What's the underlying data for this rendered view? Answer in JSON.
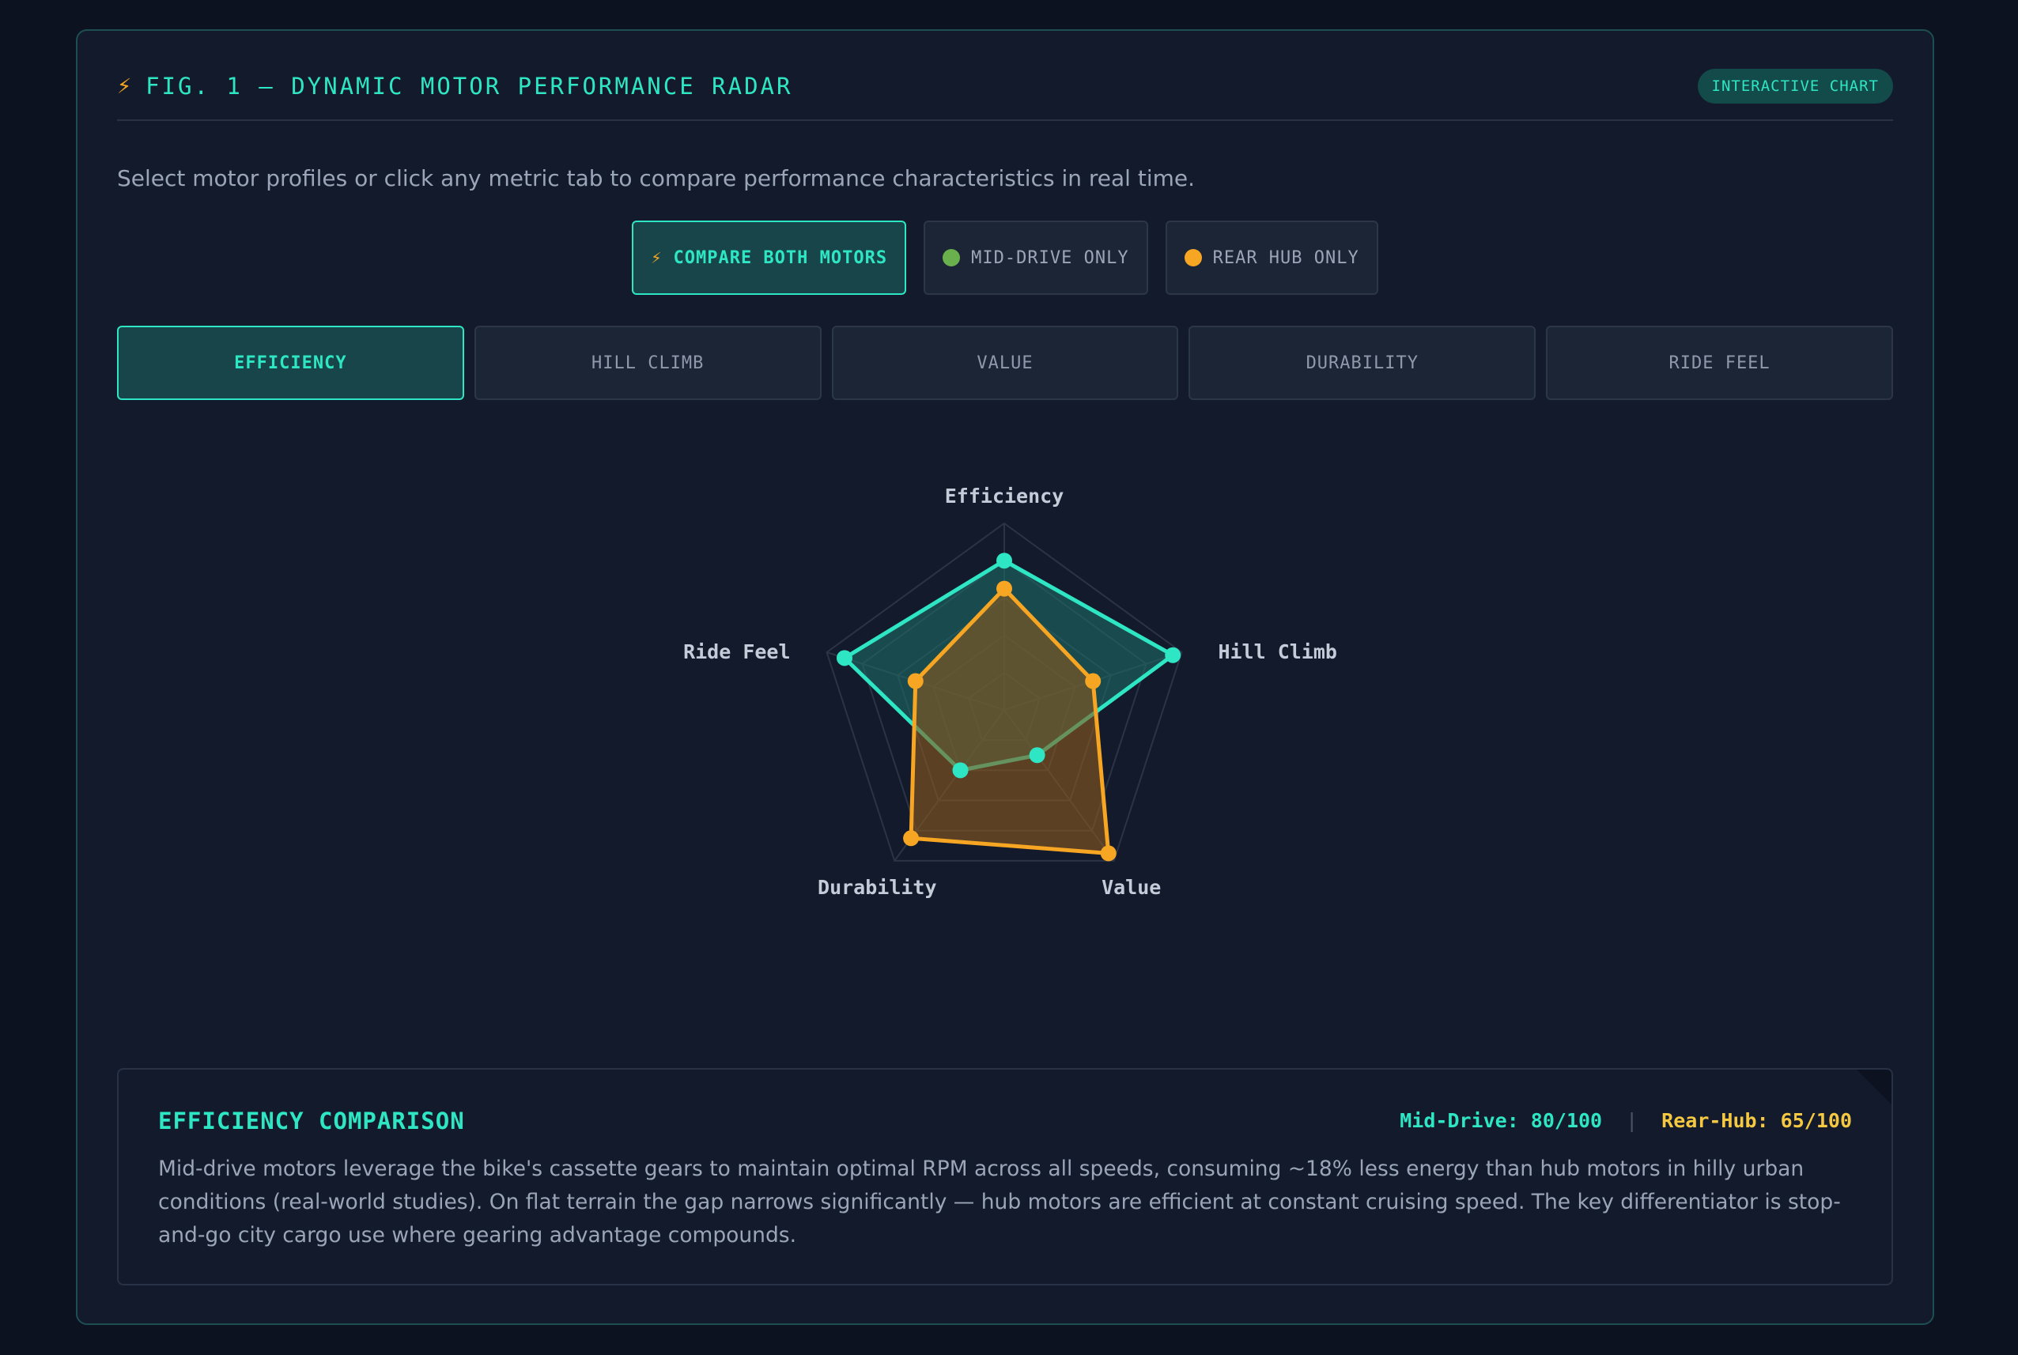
{
  "header": {
    "title": "FIG. 1 — DYNAMIC MOTOR PERFORMANCE RADAR",
    "badge": "INTERACTIVE CHART"
  },
  "subtitle": "Select motor profiles or click any metric tab to compare performance characteristics in real time.",
  "profiles": [
    {
      "label": "COMPARE BOTH MOTORS",
      "active": true,
      "icon": "lightning-bolt-icon"
    },
    {
      "label": "MID-DRIVE ONLY",
      "active": false,
      "dot_color": "#6ab04c"
    },
    {
      "label": "REAR HUB ONLY",
      "active": false,
      "dot_color": "#f6a623"
    }
  ],
  "tabs": [
    {
      "label": "EFFICIENCY",
      "active": true
    },
    {
      "label": "HILL CLIMB",
      "active": false
    },
    {
      "label": "VALUE",
      "active": false
    },
    {
      "label": "DURABILITY",
      "active": false
    },
    {
      "label": "RIDE FEEL",
      "active": false
    }
  ],
  "chart_data": {
    "type": "radar",
    "axes": [
      "Efficiency",
      "Hill Climb",
      "Value",
      "Durability",
      "Ride Feel"
    ],
    "range": [
      0,
      100
    ],
    "grid_levels": 5,
    "series": [
      {
        "key": "mid-drive",
        "values": [
          80,
          95,
          30,
          40,
          90
        ],
        "color": "#2ee6c3",
        "fill": "#1e6a66"
      },
      {
        "key": "rear-hub",
        "values": [
          65,
          50,
          95,
          85,
          50
        ],
        "color": "#f6a623",
        "fill": "#8c5a1e"
      }
    ]
  },
  "info": {
    "title": "EFFICIENCY COMPARISON",
    "mid_score": "Mid-Drive: 80/100",
    "separator": "|",
    "rear_score": "Rear-Hub: 65/100",
    "body": "Mid-drive motors leverage the bike's cassette gears to maintain optimal RPM across all speeds, consuming ~18% less energy than hub motors in hilly urban conditions (real-world studies). On flat terrain the gap narrows significantly — hub motors are efficient at constant cruising speed. The key differentiator is stop-and-go city cargo use where gearing advantage compounds."
  },
  "colors": {
    "accent": "#2ee6c3",
    "mid_drive": "#2ee6c3",
    "rear_hub": "#f6a623",
    "rear_hub_score": "#f5c842",
    "background": "#0c1220",
    "panel": "#131a2b"
  }
}
